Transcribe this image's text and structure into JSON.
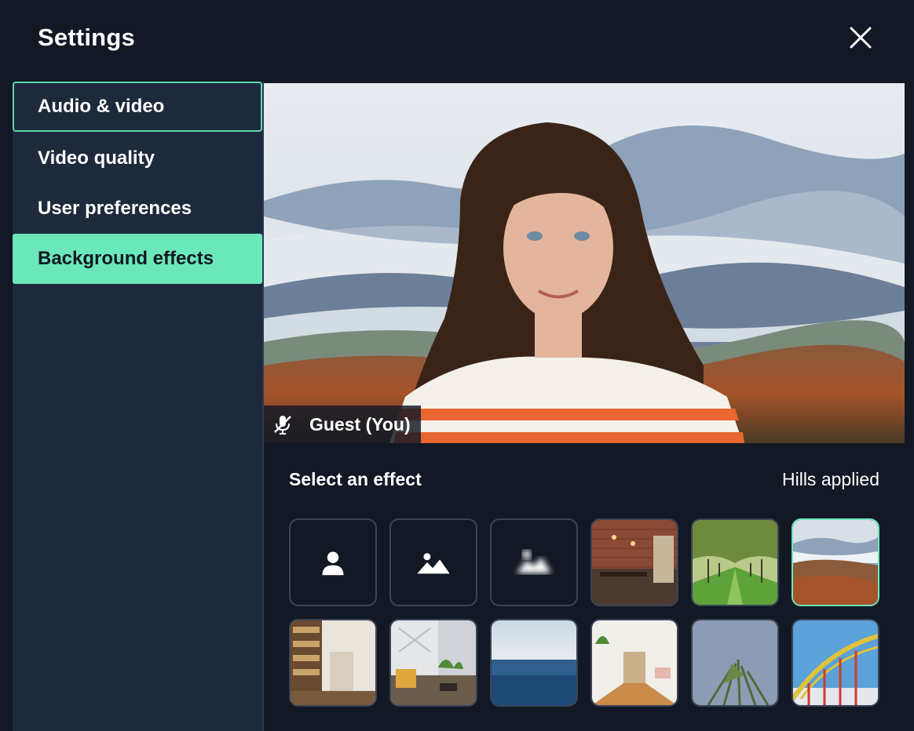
{
  "dialog": {
    "title": "Settings",
    "close_icon": "close-icon"
  },
  "sidebar": {
    "items": [
      {
        "label": "Audio & video",
        "state": "focused"
      },
      {
        "label": "Video quality",
        "state": "normal"
      },
      {
        "label": "User preferences",
        "state": "normal"
      },
      {
        "label": "Background effects",
        "state": "active"
      }
    ]
  },
  "preview": {
    "participant": "Guest (You)",
    "mic_icon": "mic-muted-icon"
  },
  "effects": {
    "heading": "Select an effect",
    "status": "Hills applied",
    "tiles": [
      {
        "name": "none",
        "icon": "person-icon"
      },
      {
        "name": "blur-light",
        "icon": "image-soft-icon"
      },
      {
        "name": "blur-strong",
        "icon": "cloud-blur-icon"
      },
      {
        "name": "brick-room"
      },
      {
        "name": "orchard"
      },
      {
        "name": "hills",
        "selected": true
      },
      {
        "name": "library"
      },
      {
        "name": "lounge"
      },
      {
        "name": "ocean"
      },
      {
        "name": "hallway"
      },
      {
        "name": "palm"
      },
      {
        "name": "rollercoaster"
      }
    ]
  },
  "colors": {
    "accent": "#6be8b9",
    "panel": "#1e2a3c",
    "background": "#121824"
  }
}
